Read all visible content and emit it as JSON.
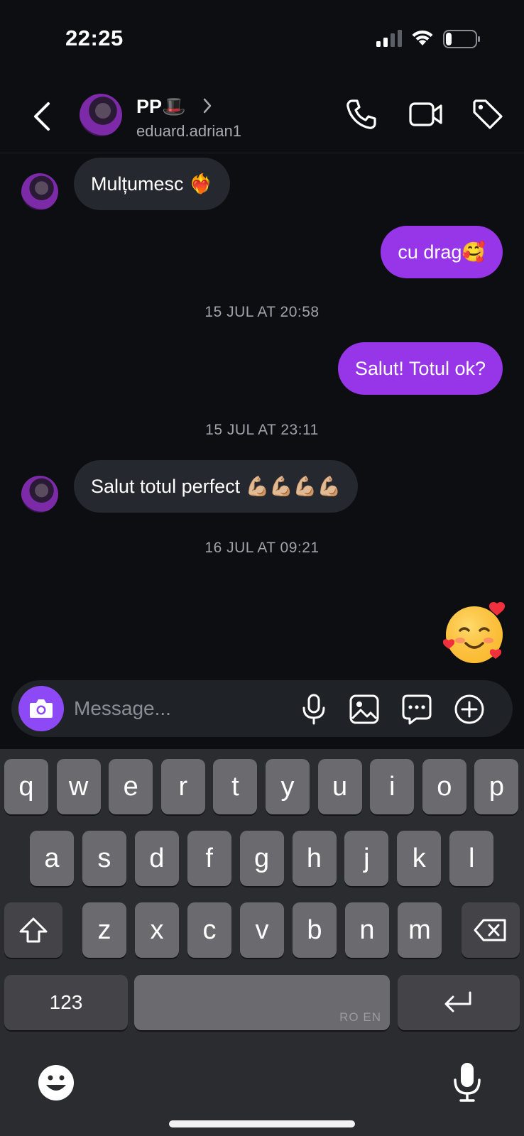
{
  "status_bar": {
    "time": "22:25",
    "battery_level": 0.2
  },
  "header": {
    "name": "PP🎩",
    "username": "eduard.adrian1"
  },
  "messages": [
    {
      "direction": "in",
      "text": "Mulțumesc ❤️‍🔥"
    },
    {
      "direction": "out",
      "text": "cu drag🥰"
    },
    {
      "type": "timestamp",
      "text": "15 JUL AT 20:58"
    },
    {
      "direction": "out",
      "text": "Salut! Totul ok?"
    },
    {
      "type": "timestamp",
      "text": "15 JUL AT 23:11"
    },
    {
      "direction": "in",
      "text": "Salut totul perfect 💪🏼💪🏼💪🏼💪🏼"
    },
    {
      "type": "timestamp",
      "text": "16 JUL AT 09:21"
    },
    {
      "direction": "out",
      "type": "emoji",
      "icon": "smiling-face-with-hearts"
    }
  ],
  "composer": {
    "placeholder": "Message..."
  },
  "keyboard": {
    "row1": [
      "q",
      "w",
      "e",
      "r",
      "t",
      "y",
      "u",
      "i",
      "o",
      "p"
    ],
    "row2": [
      "a",
      "s",
      "d",
      "f",
      "g",
      "h",
      "j",
      "k",
      "l"
    ],
    "row3": [
      "z",
      "x",
      "c",
      "v",
      "b",
      "n",
      "m"
    ],
    "numbers_label": "123",
    "language_label": "RO EN"
  },
  "colors": {
    "background": "#0c0e12",
    "outgoing_bubble": "#9736e8",
    "incoming_bubble": "#25282e",
    "camera_button": "#8d49f5",
    "keyboard_bg": "#2b2c2f"
  }
}
